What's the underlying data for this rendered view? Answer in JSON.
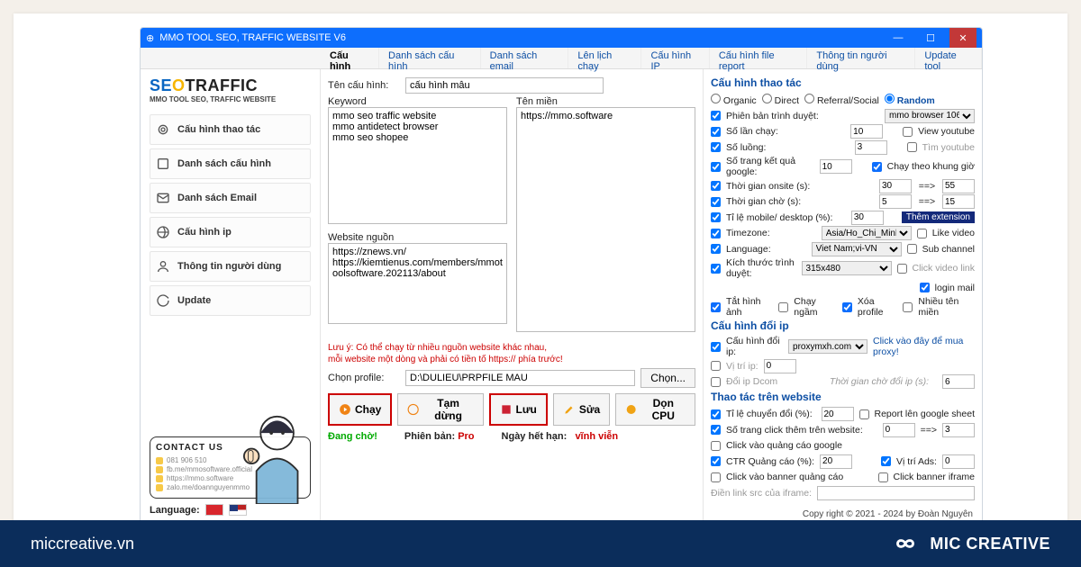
{
  "footer": {
    "site": "miccreative.vn",
    "brand": "MIC CREATIVE"
  },
  "window": {
    "title": "MMO TOOL SEO, TRAFFIC WEBSITE V6"
  },
  "tabs": [
    "Cấu hình",
    "Danh sách cấu hình",
    "Danh sách email",
    "Lên lịch chạy",
    "Cấu hình IP",
    "Cấu hình file report",
    "Thông tin người dùng",
    "Update tool"
  ],
  "logo": {
    "a": "SE",
    "b": "O",
    "c": "TRAFFIC",
    "sub": "MMO TOOL SEO, TRAFFIC WEBSITE"
  },
  "nav": [
    "Cấu hình thao tác",
    "Danh sách cấu hình",
    "Danh sách Email",
    "Cấu hình ip",
    "Thông tin người dùng",
    "Update"
  ],
  "contact": {
    "title": "CONTACT US",
    "rows": [
      "081 906 510",
      "fb.me/mmosoftware.official",
      "https://mmo.software",
      "zalo.me/doannguyenmmo"
    ]
  },
  "lang_label": "Language:",
  "form": {
    "name_lab": "Tên cấu hình:",
    "name_val": "cấu hình mẫu",
    "kw_lab": "Keyword",
    "kw_val": "mmo seo traffic website\nmmo antidetect browser\nmmo seo shopee",
    "dom_lab": "Tên miền",
    "dom_val": "https://mmo.software",
    "src_lab": "Website nguồn",
    "src_val": "https://znews.vn/\nhttps://kiemtienus.com/members/mmotoolsoftware.202113/about",
    "note1": "Lưu ý: Có thể chạy từ nhiều nguồn website khác nhau,",
    "note2": "mỗi website một dòng và phải có tiền tố https:// phía trước!",
    "prof_lab": "Chọn profile:",
    "prof_val": "D:\\DULIEU\\PRPFILE MAU",
    "choose": "Chọn...",
    "btns": {
      "run": "Chạy",
      "pause": "Tạm dừng",
      "save": "Lưu",
      "edit": "Sửa",
      "clean": "Dọn CPU"
    },
    "status": {
      "wait": "Đang chờ!",
      "ver_l": "Phiên bản:",
      "ver_v": "Pro",
      "exp_l": "Ngày hết hạn:",
      "exp_v": "vĩnh viễn"
    }
  },
  "cfg": {
    "h1": "Cấu hình thao tác",
    "modes": [
      "Organic",
      "Direct",
      "Referral/Social",
      "Random"
    ],
    "rows": {
      "ver": "Phiên bản trình duyệt:",
      "ver_v": "mmo browser 106",
      "runs": "Số lần chạy:",
      "runs_v": "10",
      "view_yt": "View youtube",
      "threads": "Số luồng:",
      "threads_v": "3",
      "find_yt": "Tìm youtube",
      "pages": "Số trang kết quả google:",
      "pages_v": "10",
      "frame": "Chạy theo khung giờ",
      "onsite": "Thời gian onsite (s):",
      "onsite_a": "30",
      "onsite_b": "55",
      "arrow": "==>",
      "wait": "Thời gian chờ (s):",
      "wait_a": "5",
      "wait_b": "15",
      "ratio": "Tỉ lệ mobile/ desktop (%):",
      "ratio_v": "30",
      "ext": "Thêm extension",
      "tz": "Timezone:",
      "tz_v": "Asia/Ho_Chi_Minh",
      "like": "Like video",
      "lang": "Language:",
      "lang_v": "Viet Nam;vi-VN",
      "sub": "Sub channel",
      "size": "Kích thước trình duyệt:",
      "size_v": "315x480",
      "clk": "Click video link",
      "login": "login mail",
      "off": "Tắt hình ảnh",
      "bg": "Chạy ngầm",
      "del": "Xóa profile",
      "multi": "Nhiều tên miền"
    },
    "h2": "Cấu hình đổi ip",
    "ip": {
      "lab": "Cấu hình đổi ip:",
      "sel": "proxymxh.com",
      "buy": "Click vào đây để mua proxy!",
      "pos": "Vị trí ip:",
      "pos_v": "0",
      "dcom": "Đổi ip Dcom",
      "wait": "Thời gian chờ đổi ip (s):",
      "wait_v": "6"
    },
    "h3": "Thao tác trên website",
    "web": {
      "conv": "Tỉ lệ chuyển đổi (%):",
      "conv_v": "20",
      "report": "Report lên google sheet",
      "more": "Số trang click thêm trên website:",
      "more_a": "0",
      "more_b": "3",
      "ads": "Click vào quảng cáo google",
      "ctr": "CTR Quảng cáo (%):",
      "ctr_v": "20",
      "adpos": "Vị trí Ads:",
      "adpos_v": "0",
      "banner": "Click vào banner quảng cáo",
      "iframe": "Click banner iframe",
      "src": "Điền link src của iframe:"
    }
  },
  "copyright": "Copy right © 2021 - 2024 by Đoàn Nguyên"
}
